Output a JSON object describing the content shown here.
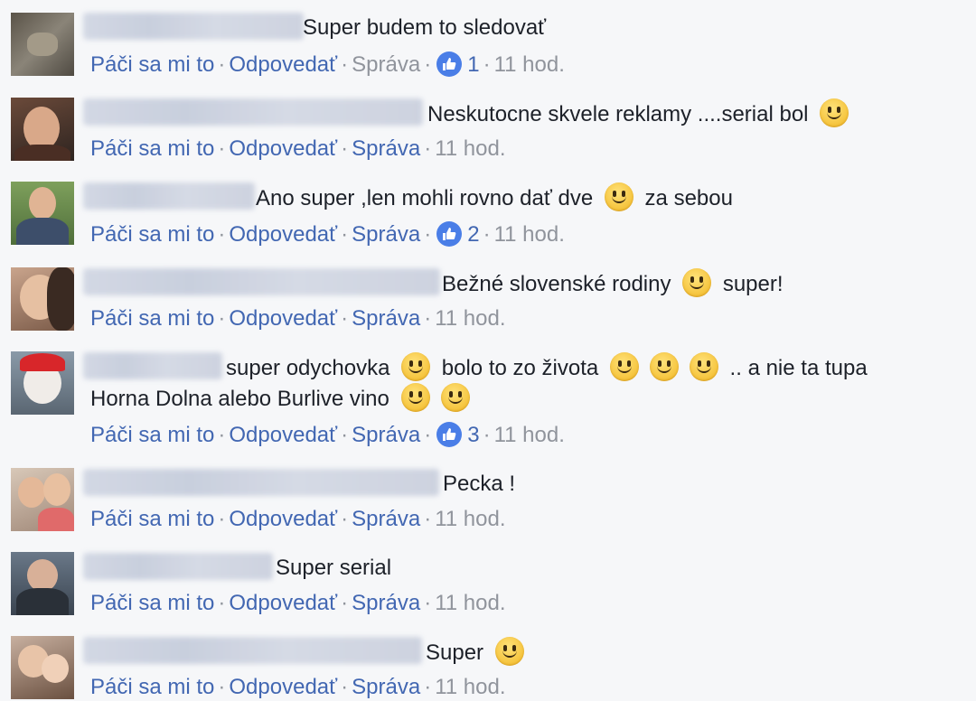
{
  "actions": {
    "like": "Páči sa mi to",
    "reply": "Odpovedať",
    "message": "Správa",
    "separator": "·"
  },
  "colors": {
    "link": "#4267b2",
    "meta": "#90949c",
    "background": "#f6f7f9",
    "like_badge": "#4a7ee7"
  },
  "comments": [
    {
      "text_parts": [
        "Super budem to sledovať"
      ],
      "likes": "1",
      "time": "11 hod.",
      "avatar_icon": "avatar-image"
    },
    {
      "text_parts": [
        "Neskutocne skvele reklamy ....serial bol "
      ],
      "likes": "",
      "time": "11 hod.",
      "avatar_icon": "avatar-image",
      "emoji_count": 1
    },
    {
      "text_parts": [
        "Ano super ,len mohli rovno dať dve ",
        " za sebou"
      ],
      "likes": "2",
      "time": "11 hod.",
      "avatar_icon": "avatar-image"
    },
    {
      "text_parts": [
        "Bežné slovenské rodiny ",
        " super!"
      ],
      "likes": "",
      "time": "11 hod.",
      "avatar_icon": "avatar-image"
    },
    {
      "text_parts": [
        "super odychovka ",
        " bolo to zo života ",
        " .. a nie ta tupa"
      ],
      "text_line2": "Horna Dolna alebo Burlive vino ",
      "likes": "3",
      "time": "11 hod.",
      "avatar_icon": "avatar-image"
    },
    {
      "text_parts": [
        "Pecka !"
      ],
      "likes": "",
      "time": "11 hod.",
      "avatar_icon": "avatar-image"
    },
    {
      "text_parts": [
        "Super serial"
      ],
      "likes": "",
      "time": "11 hod.",
      "avatar_icon": "avatar-image"
    },
    {
      "text_parts": [
        "Super "
      ],
      "likes": "",
      "time": "11 hod.",
      "avatar_icon": "avatar-image"
    }
  ]
}
